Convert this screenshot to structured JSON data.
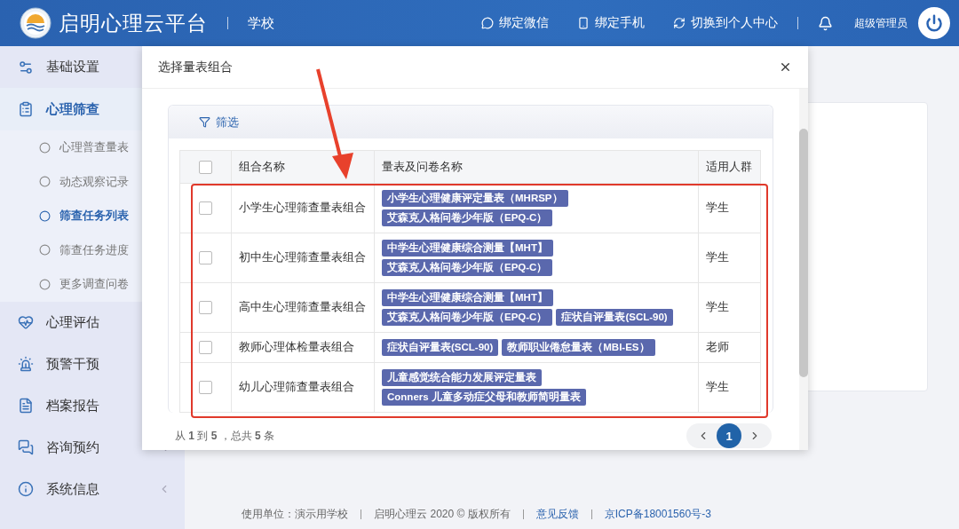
{
  "header": {
    "title": "启明心理云平台",
    "section": "学校",
    "actions": [
      {
        "kind": "wechat",
        "label": "绑定微信"
      },
      {
        "kind": "phone",
        "label": "绑定手机"
      },
      {
        "kind": "switch",
        "label": "切换到个人中心"
      }
    ],
    "user": "超级管理员"
  },
  "sidebar": {
    "items": [
      {
        "label": "基础设置",
        "selected": false
      },
      {
        "label": "心理筛查",
        "selected": true,
        "children": [
          {
            "label": "心理普查量表",
            "selected": false
          },
          {
            "label": "动态观察记录",
            "selected": false
          },
          {
            "label": "筛查任务列表",
            "selected": true
          },
          {
            "label": "筛查任务进度",
            "selected": false
          },
          {
            "label": "更多调查问卷",
            "selected": false
          }
        ]
      },
      {
        "label": "心理评估",
        "selected": false
      },
      {
        "label": "预警干预",
        "selected": false
      },
      {
        "label": "档案报告",
        "selected": false
      },
      {
        "label": "咨询预约",
        "selected": false,
        "arrow": true
      },
      {
        "label": "系统信息",
        "selected": false,
        "arrow": true
      }
    ]
  },
  "dialog": {
    "title": "选择量表组合",
    "filter": "筛选",
    "table": {
      "all_checked": false,
      "columns": [
        "组合名称",
        "量表及问卷名称",
        "适用人群"
      ],
      "rows": [
        {
          "checked": false,
          "name": "小学生心理筛查量表组合",
          "scales": [
            "小学生心理健康评定量表（MHRSP）",
            "艾森克人格问卷少年版（EPQ-C）"
          ],
          "audience": "学生"
        },
        {
          "checked": false,
          "name": "初中生心理筛查量表组合",
          "scales": [
            "中学生心理健康综合测量【MHT】",
            "艾森克人格问卷少年版（EPQ-C）"
          ],
          "audience": "学生"
        },
        {
          "checked": false,
          "name": "高中生心理筛查量表组合",
          "scales": [
            "中学生心理健康综合测量【MHT】",
            "艾森克人格问卷少年版（EPQ-C）",
            "症状自评量表(SCL-90)"
          ],
          "audience": "学生"
        },
        {
          "checked": false,
          "name": "教师心理体检量表组合",
          "scales": [
            "症状自评量表(SCL-90)",
            "教师职业倦怠量表（MBI-ES）"
          ],
          "audience": "老师"
        },
        {
          "checked": false,
          "name": "幼儿心理筛查量表组合",
          "scales": [
            "儿童感觉统合能力发展评定量表",
            "Conners 儿童多动症父母和教师简明量表"
          ],
          "audience": "学生"
        }
      ]
    },
    "summary": "从 **1** 到 **5** ，总共 **5** 条",
    "pages": [
      {
        "label": "1",
        "selected": true
      }
    ]
  },
  "footer": [
    {
      "kind": "text",
      "text": "使用单位：演示用学校"
    },
    {
      "kind": "text",
      "text": "启明心理云 2020  ©  版权所有"
    },
    {
      "kind": "link",
      "text": "意见反馈"
    },
    {
      "kind": "link",
      "text": "京ICP备18001560号-3"
    }
  ]
}
